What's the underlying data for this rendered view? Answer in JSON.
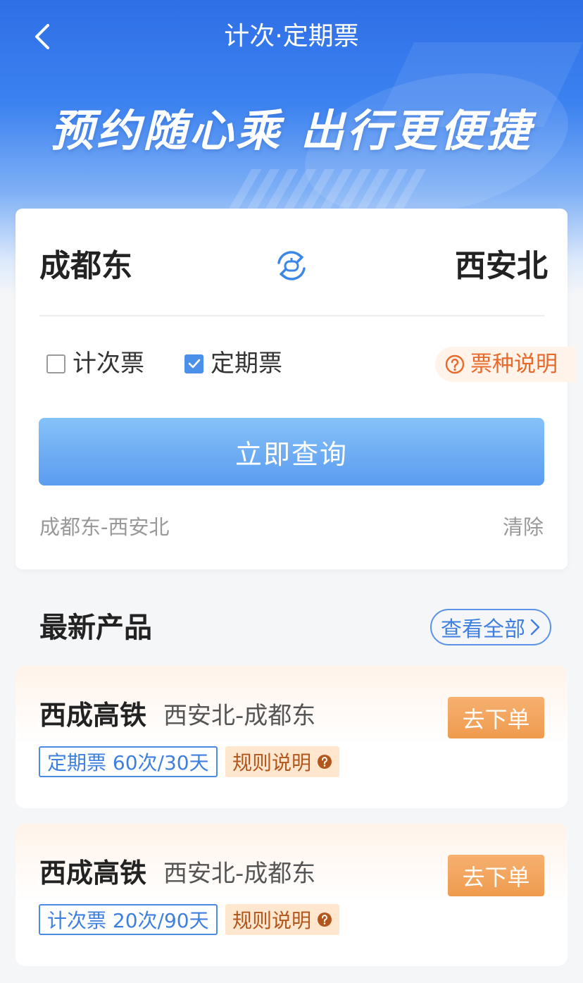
{
  "header": {
    "title": "计次·定期票",
    "slogan": "预约随心乘 出行更便捷"
  },
  "search": {
    "from_station": "成都东",
    "to_station": "西安北",
    "ticket_types": [
      {
        "label": "计次票",
        "checked": false
      },
      {
        "label": "定期票",
        "checked": true
      }
    ],
    "help_label": "票种说明",
    "query_button": "立即查询",
    "history_item": "成都东-西安北",
    "clear_label": "清除"
  },
  "products": {
    "section_title": "最新产品",
    "view_all_label": "查看全部",
    "items": [
      {
        "name": "西成高铁",
        "route": "西安北-成都东",
        "tag": "定期票 60次/30天",
        "rule_label": "规则说明",
        "order_label": "去下单"
      },
      {
        "name": "西成高铁",
        "route": "西安北-成都东",
        "tag": "计次票 20次/90天",
        "rule_label": "规则说明",
        "order_label": "去下单"
      }
    ]
  },
  "colors": {
    "primary_blue": "#4a90e8",
    "accent_orange": "#ef9b4e",
    "help_orange": "#e8692a"
  }
}
